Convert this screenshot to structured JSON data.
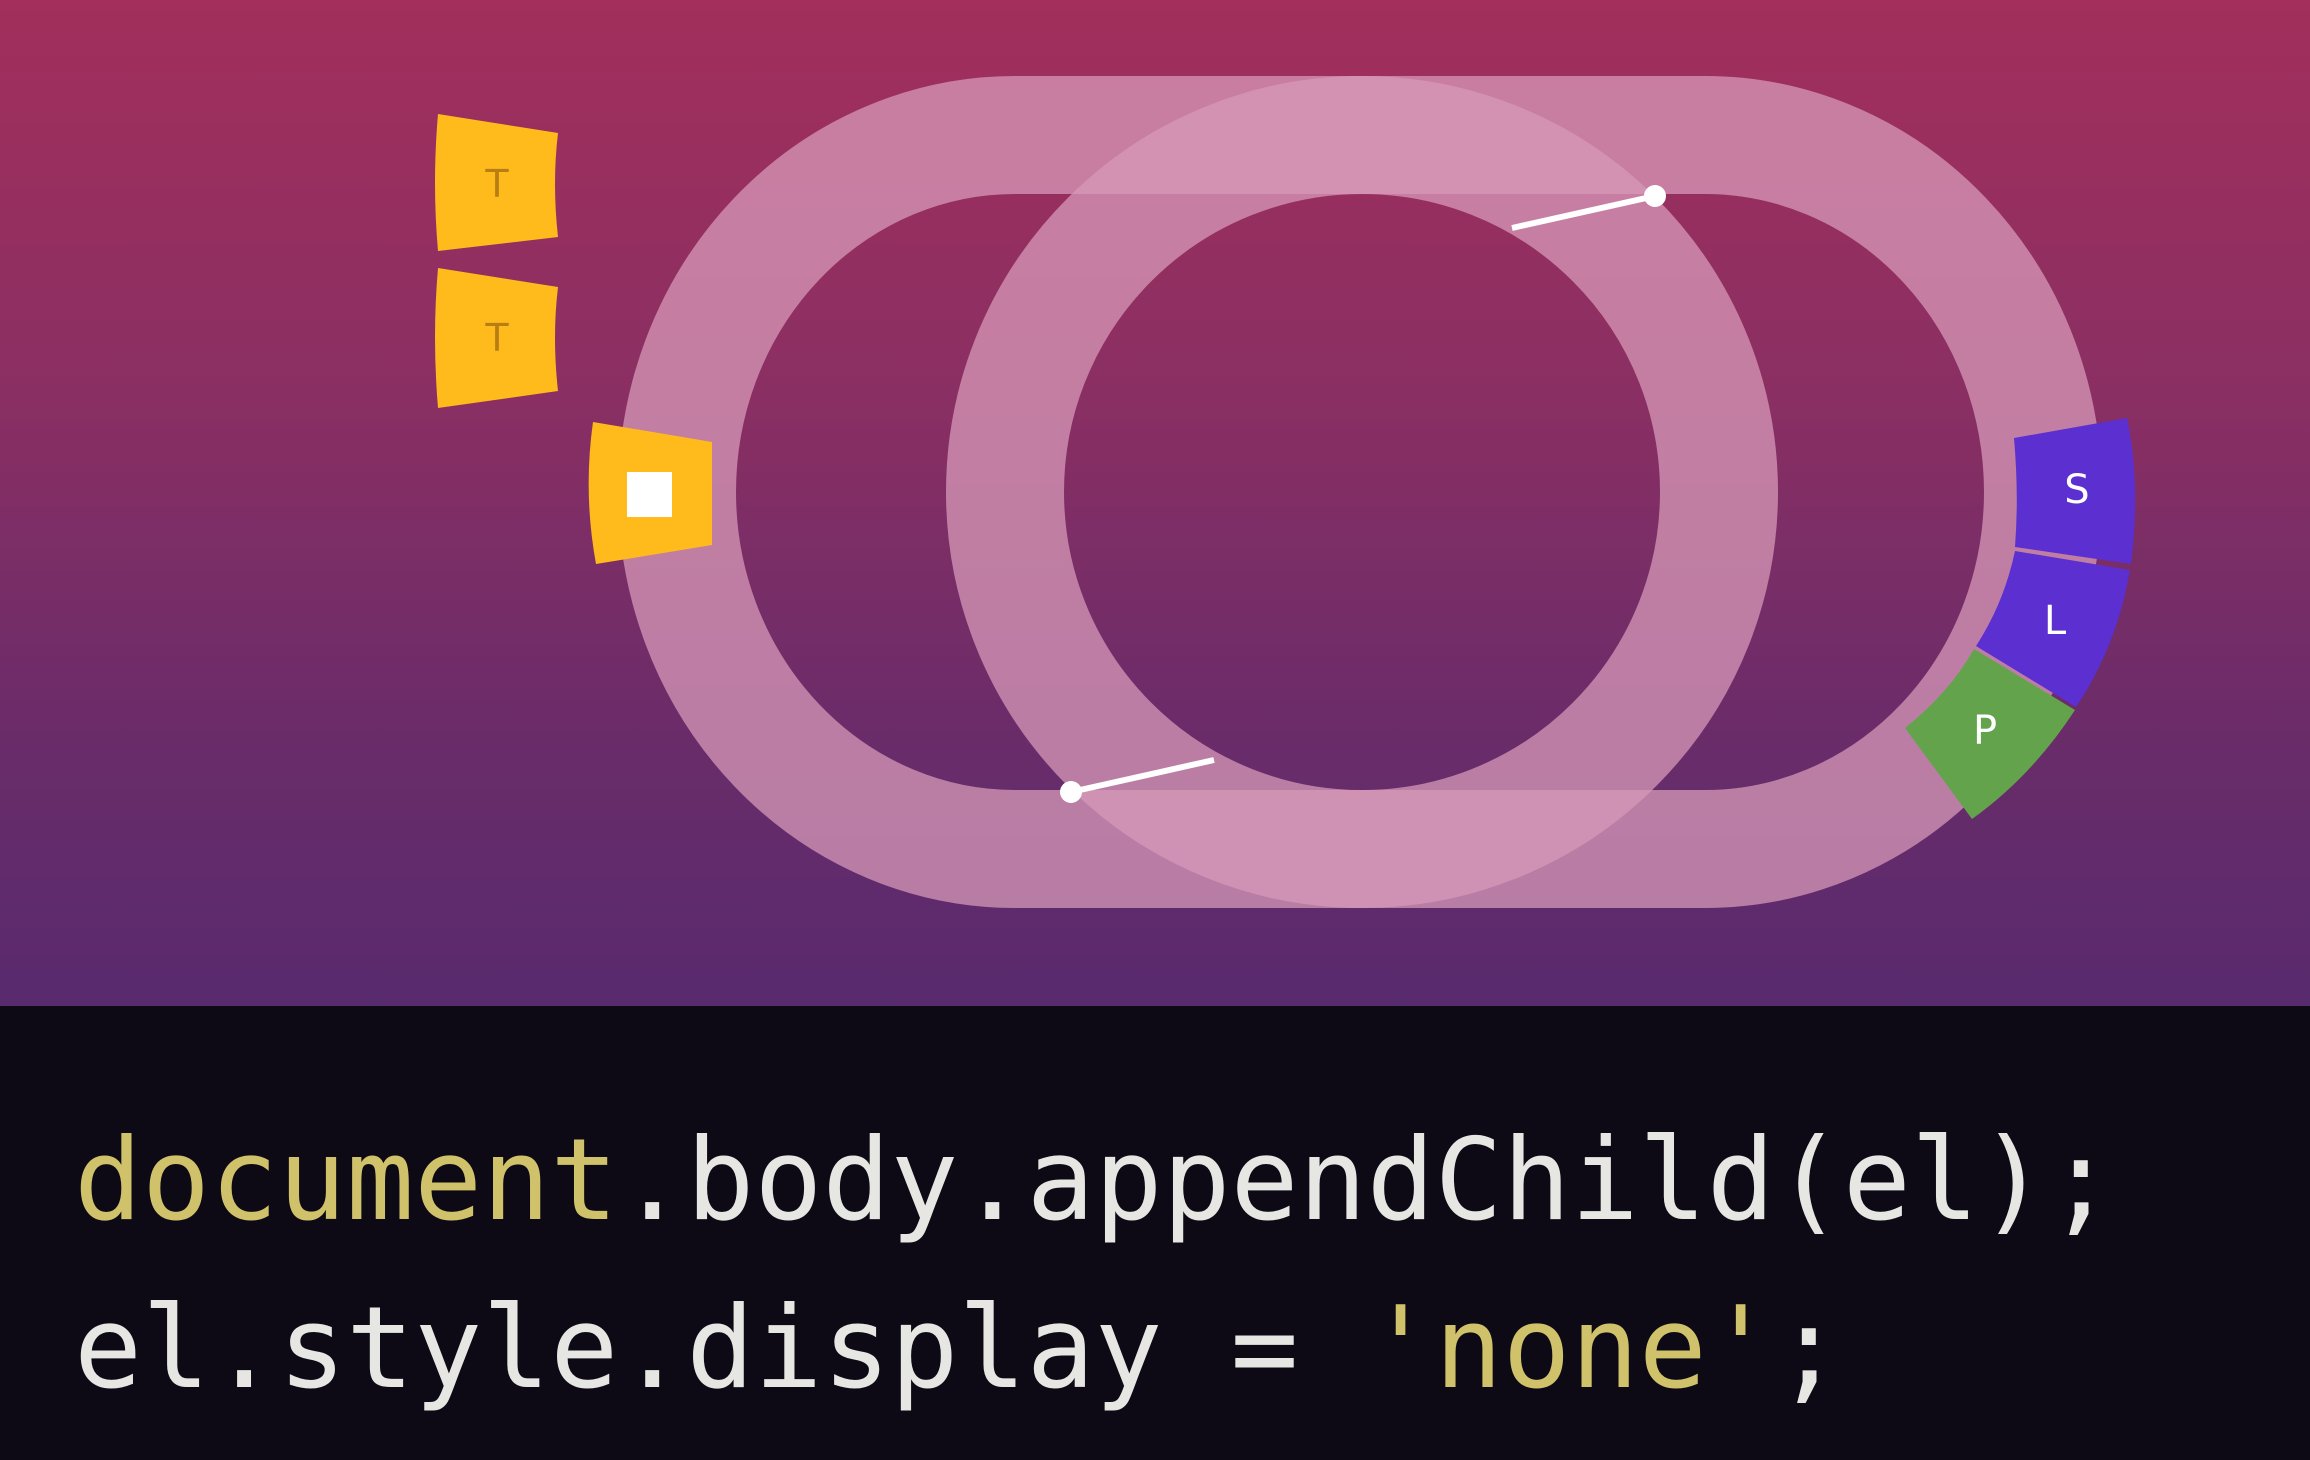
{
  "colors": {
    "track": "#d89ab9",
    "task_tile": "#ffbb1c",
    "style_tile": "#5b2fd0",
    "layout_tile": "#5b2fd0",
    "paint_tile": "#63a34c",
    "code_keyword": "#cfc26a",
    "code_text": "#e6e6e3",
    "code_background": "#0d0a15"
  },
  "queue_tiles": [
    {
      "label": "T"
    },
    {
      "label": "T"
    }
  ],
  "track_tiles": {
    "task_marker_icon": "white-square-icon",
    "style_label": "S",
    "layout_label": "L",
    "paint_label": "P"
  },
  "code": {
    "line1": {
      "keyword": "document",
      "rest": ".body.appendChild(el);"
    },
    "line2": {
      "before": "el.style.display = ",
      "string": "'none'",
      "after": ";"
    }
  }
}
